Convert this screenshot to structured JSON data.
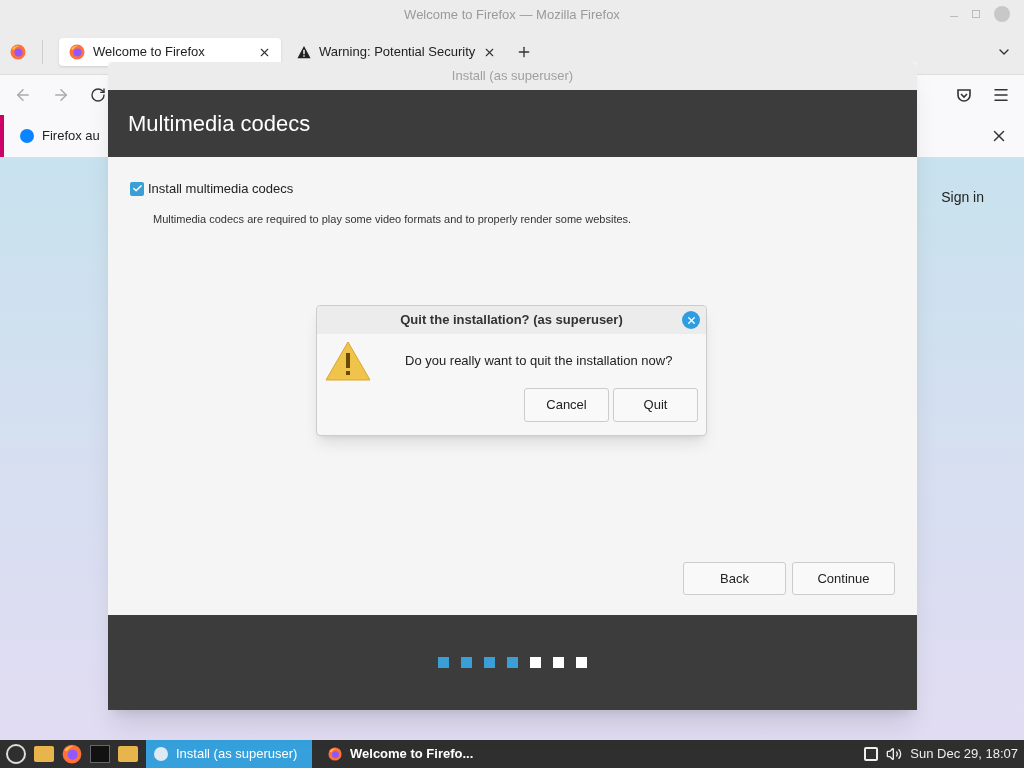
{
  "firefox": {
    "title": "Welcome to Firefox — Mozilla Firefox",
    "tabs": [
      {
        "label": "Welcome to Firefox",
        "kind": "page",
        "selected": true
      },
      {
        "label": "Warning: Potential Security",
        "kind": "warning",
        "selected": false
      }
    ],
    "notification": "Firefox au",
    "sign_in": "Sign in"
  },
  "installer": {
    "title": "Install (as superuser)",
    "heading": "Multimedia codecs",
    "option": {
      "label": "Install multimedia codecs",
      "checked": true
    },
    "description": "Multimedia codecs are required to play some video formats and to properly render some websites.",
    "buttons": [
      "Back",
      "Continue"
    ],
    "steps": [
      {
        "done": true
      },
      {
        "done": true
      },
      {
        "done": true
      },
      {
        "done": true
      },
      {
        "done": false
      },
      {
        "done": false
      },
      {
        "done": false
      }
    ]
  },
  "dialog": {
    "title": "Quit the installation? (as superuser)",
    "message": "Do you really want to quit the installation now?",
    "buttons": [
      "Cancel",
      "Quit"
    ]
  },
  "taskbar": {
    "windows": [
      {
        "label": "Install (as superuser)",
        "kind": "installer",
        "selected": true
      },
      {
        "label": "Welcome to Firefo...",
        "kind": "browser",
        "selected": false
      }
    ],
    "clock": "Sun Dec 29, 18:07"
  }
}
